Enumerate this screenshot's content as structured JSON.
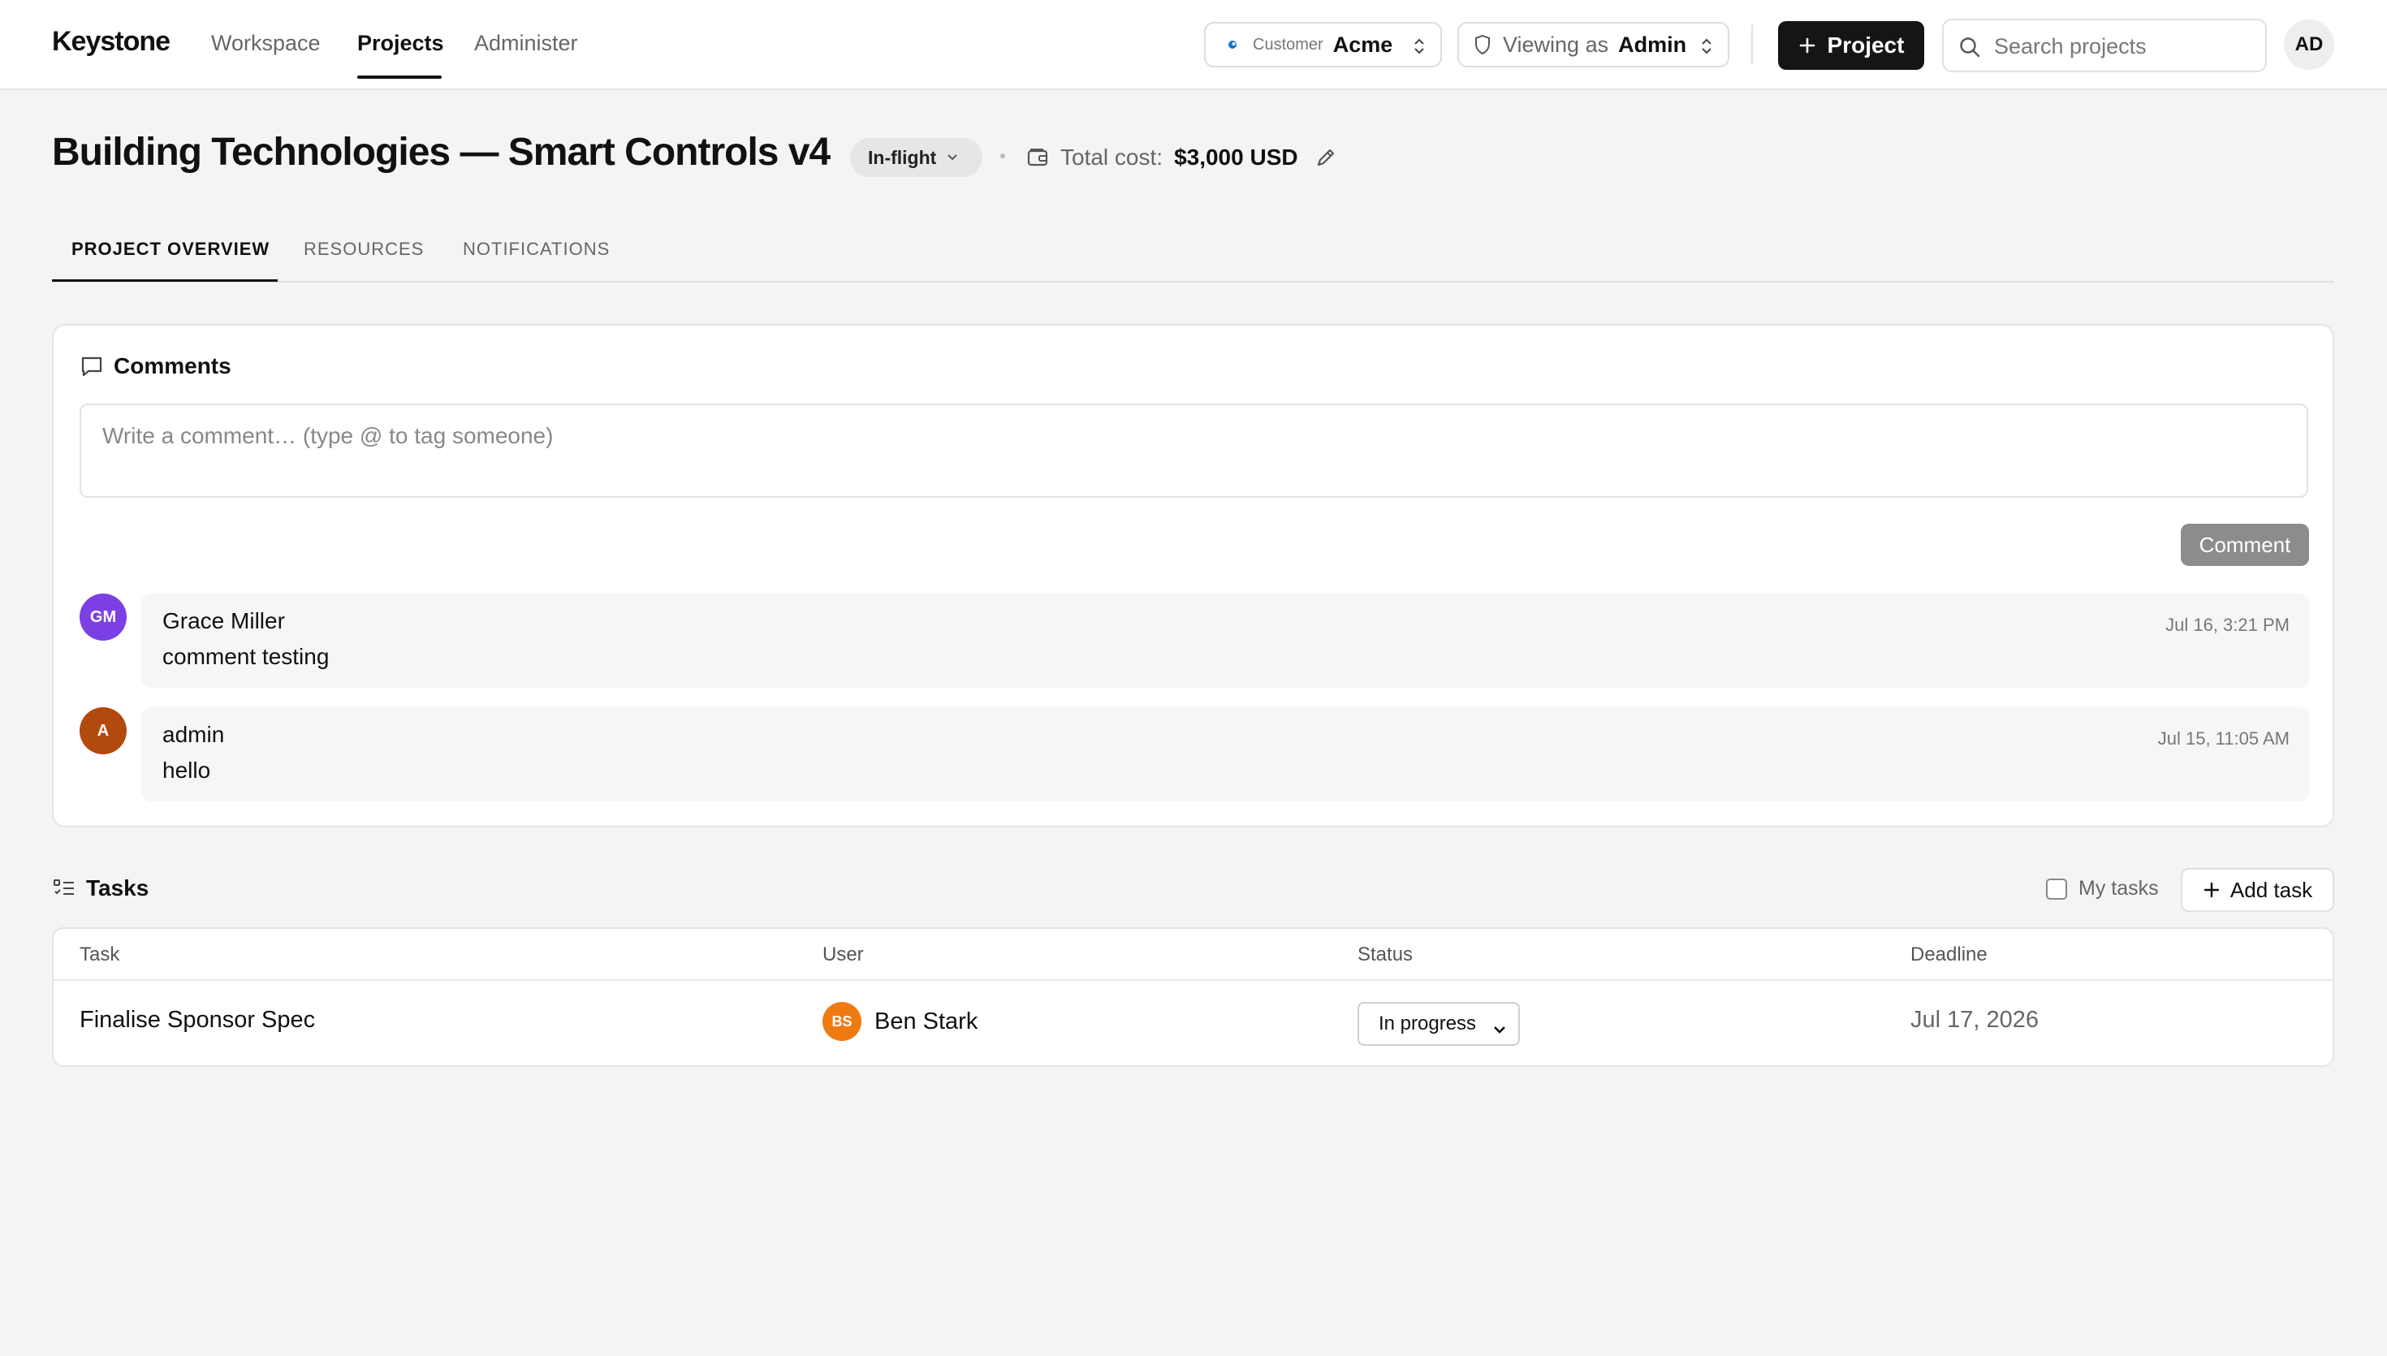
{
  "app": {
    "brand": "Keystone"
  },
  "nav": [
    {
      "label": "Workspace"
    },
    {
      "label": "Projects"
    },
    {
      "label": "Administer"
    }
  ],
  "customer": {
    "label": "Customer",
    "value": "Acme"
  },
  "viewing": {
    "label": "Viewing as",
    "value": "Admin"
  },
  "actions": {
    "new_project": "Project",
    "search_placeholder": "Search projects"
  },
  "user": {
    "initials": "AD"
  },
  "project": {
    "title": "Building Technologies — Smart Controls v4",
    "status": "In-flight",
    "cost_label": "Total cost:",
    "cost_value": "$3,000 USD"
  },
  "tabs": [
    {
      "label": "PROJECT OVERVIEW"
    },
    {
      "label": "RESOURCES"
    },
    {
      "label": "NOTIFICATIONS"
    }
  ],
  "comments": {
    "heading": "Comments",
    "placeholder": "Write a comment… (type @ to tag someone)",
    "submit": "Comment",
    "items": [
      {
        "initials": "GM",
        "author": "Grace Miller",
        "body": "comment testing",
        "time": "Jul 16, 3:21 PM",
        "color": "#7b3fe4"
      },
      {
        "initials": "A",
        "author": "admin",
        "body": "hello",
        "time": "Jul 15, 11:05 AM",
        "color": "#b24a0f"
      }
    ]
  },
  "tasks": {
    "heading": "Tasks",
    "my_tasks": "My tasks",
    "add": "Add task",
    "columns": [
      "Task",
      "User",
      "Status",
      "Deadline"
    ],
    "rows": [
      {
        "task": "Finalise Sponsor Spec",
        "user_initials": "BS",
        "user": "Ben Stark",
        "status": "In progress",
        "deadline": "Jul 17, 2026"
      }
    ]
  },
  "colors": {
    "primary_button": "#151515",
    "accent_avatar_orange": "#f07a12"
  }
}
